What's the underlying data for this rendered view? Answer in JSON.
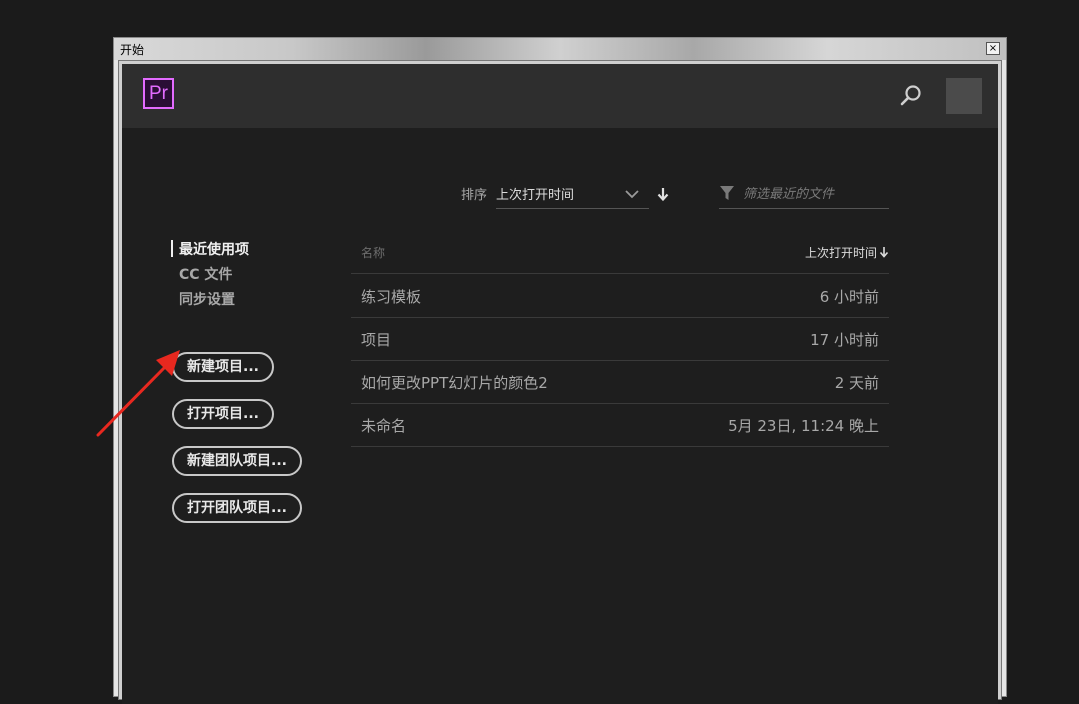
{
  "window": {
    "title": "开始",
    "close_label": "×"
  },
  "app": {
    "logo_text": "Pr",
    "accent": "#e36bff"
  },
  "header": {
    "search_icon": "search-icon",
    "avatar_icon": "avatar"
  },
  "sort": {
    "label": "排序",
    "value": "上次打开时间"
  },
  "filter": {
    "placeholder": "筛选最近的文件"
  },
  "nav": {
    "items": [
      {
        "label": "最近使用项",
        "active": true
      },
      {
        "label": "CC 文件",
        "active": false
      },
      {
        "label": "同步设置",
        "active": false
      }
    ]
  },
  "buttons": {
    "new_project": "新建项目...",
    "open_project": "打开项目...",
    "new_team_project": "新建团队项目...",
    "open_team_project": "打开团队项目..."
  },
  "table": {
    "col_name": "名称",
    "col_date": "上次打开时间",
    "rows": [
      {
        "name": "练习模板",
        "date": "6 小时前"
      },
      {
        "name": "项目",
        "date": "17 小时前"
      },
      {
        "name": "如何更改PPT幻灯片的颜色2",
        "date": "2 天前"
      },
      {
        "name": "未命名",
        "date": "5月 23日, 11:24 晚上"
      }
    ]
  },
  "annotation": {
    "arrow_color": "#e8281f"
  }
}
